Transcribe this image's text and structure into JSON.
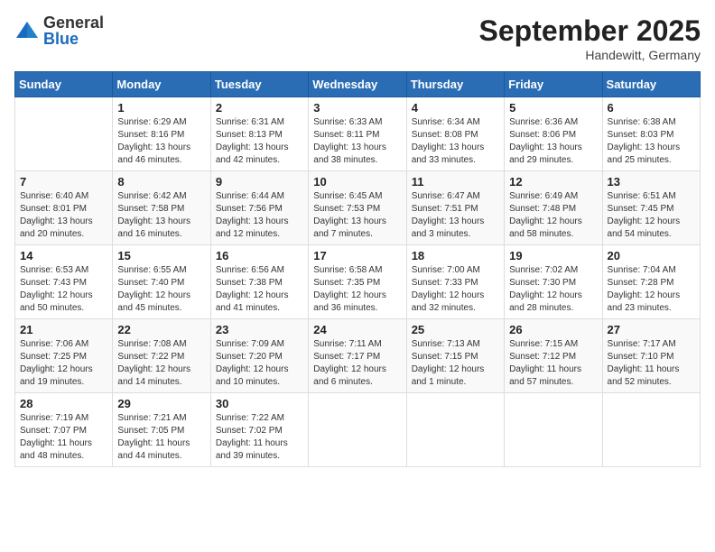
{
  "header": {
    "logo_general": "General",
    "logo_blue": "Blue",
    "month_title": "September 2025",
    "location": "Handewitt, Germany"
  },
  "days_of_week": [
    "Sunday",
    "Monday",
    "Tuesday",
    "Wednesday",
    "Thursday",
    "Friday",
    "Saturday"
  ],
  "weeks": [
    [
      {
        "day": "",
        "info": ""
      },
      {
        "day": "1",
        "info": "Sunrise: 6:29 AM\nSunset: 8:16 PM\nDaylight: 13 hours\nand 46 minutes."
      },
      {
        "day": "2",
        "info": "Sunrise: 6:31 AM\nSunset: 8:13 PM\nDaylight: 13 hours\nand 42 minutes."
      },
      {
        "day": "3",
        "info": "Sunrise: 6:33 AM\nSunset: 8:11 PM\nDaylight: 13 hours\nand 38 minutes."
      },
      {
        "day": "4",
        "info": "Sunrise: 6:34 AM\nSunset: 8:08 PM\nDaylight: 13 hours\nand 33 minutes."
      },
      {
        "day": "5",
        "info": "Sunrise: 6:36 AM\nSunset: 8:06 PM\nDaylight: 13 hours\nand 29 minutes."
      },
      {
        "day": "6",
        "info": "Sunrise: 6:38 AM\nSunset: 8:03 PM\nDaylight: 13 hours\nand 25 minutes."
      }
    ],
    [
      {
        "day": "7",
        "info": "Sunrise: 6:40 AM\nSunset: 8:01 PM\nDaylight: 13 hours\nand 20 minutes."
      },
      {
        "day": "8",
        "info": "Sunrise: 6:42 AM\nSunset: 7:58 PM\nDaylight: 13 hours\nand 16 minutes."
      },
      {
        "day": "9",
        "info": "Sunrise: 6:44 AM\nSunset: 7:56 PM\nDaylight: 13 hours\nand 12 minutes."
      },
      {
        "day": "10",
        "info": "Sunrise: 6:45 AM\nSunset: 7:53 PM\nDaylight: 13 hours\nand 7 minutes."
      },
      {
        "day": "11",
        "info": "Sunrise: 6:47 AM\nSunset: 7:51 PM\nDaylight: 13 hours\nand 3 minutes."
      },
      {
        "day": "12",
        "info": "Sunrise: 6:49 AM\nSunset: 7:48 PM\nDaylight: 12 hours\nand 58 minutes."
      },
      {
        "day": "13",
        "info": "Sunrise: 6:51 AM\nSunset: 7:45 PM\nDaylight: 12 hours\nand 54 minutes."
      }
    ],
    [
      {
        "day": "14",
        "info": "Sunrise: 6:53 AM\nSunset: 7:43 PM\nDaylight: 12 hours\nand 50 minutes."
      },
      {
        "day": "15",
        "info": "Sunrise: 6:55 AM\nSunset: 7:40 PM\nDaylight: 12 hours\nand 45 minutes."
      },
      {
        "day": "16",
        "info": "Sunrise: 6:56 AM\nSunset: 7:38 PM\nDaylight: 12 hours\nand 41 minutes."
      },
      {
        "day": "17",
        "info": "Sunrise: 6:58 AM\nSunset: 7:35 PM\nDaylight: 12 hours\nand 36 minutes."
      },
      {
        "day": "18",
        "info": "Sunrise: 7:00 AM\nSunset: 7:33 PM\nDaylight: 12 hours\nand 32 minutes."
      },
      {
        "day": "19",
        "info": "Sunrise: 7:02 AM\nSunset: 7:30 PM\nDaylight: 12 hours\nand 28 minutes."
      },
      {
        "day": "20",
        "info": "Sunrise: 7:04 AM\nSunset: 7:28 PM\nDaylight: 12 hours\nand 23 minutes."
      }
    ],
    [
      {
        "day": "21",
        "info": "Sunrise: 7:06 AM\nSunset: 7:25 PM\nDaylight: 12 hours\nand 19 minutes."
      },
      {
        "day": "22",
        "info": "Sunrise: 7:08 AM\nSunset: 7:22 PM\nDaylight: 12 hours\nand 14 minutes."
      },
      {
        "day": "23",
        "info": "Sunrise: 7:09 AM\nSunset: 7:20 PM\nDaylight: 12 hours\nand 10 minutes."
      },
      {
        "day": "24",
        "info": "Sunrise: 7:11 AM\nSunset: 7:17 PM\nDaylight: 12 hours\nand 6 minutes."
      },
      {
        "day": "25",
        "info": "Sunrise: 7:13 AM\nSunset: 7:15 PM\nDaylight: 12 hours\nand 1 minute."
      },
      {
        "day": "26",
        "info": "Sunrise: 7:15 AM\nSunset: 7:12 PM\nDaylight: 11 hours\nand 57 minutes."
      },
      {
        "day": "27",
        "info": "Sunrise: 7:17 AM\nSunset: 7:10 PM\nDaylight: 11 hours\nand 52 minutes."
      }
    ],
    [
      {
        "day": "28",
        "info": "Sunrise: 7:19 AM\nSunset: 7:07 PM\nDaylight: 11 hours\nand 48 minutes."
      },
      {
        "day": "29",
        "info": "Sunrise: 7:21 AM\nSunset: 7:05 PM\nDaylight: 11 hours\nand 44 minutes."
      },
      {
        "day": "30",
        "info": "Sunrise: 7:22 AM\nSunset: 7:02 PM\nDaylight: 11 hours\nand 39 minutes."
      },
      {
        "day": "",
        "info": ""
      },
      {
        "day": "",
        "info": ""
      },
      {
        "day": "",
        "info": ""
      },
      {
        "day": "",
        "info": ""
      }
    ]
  ]
}
